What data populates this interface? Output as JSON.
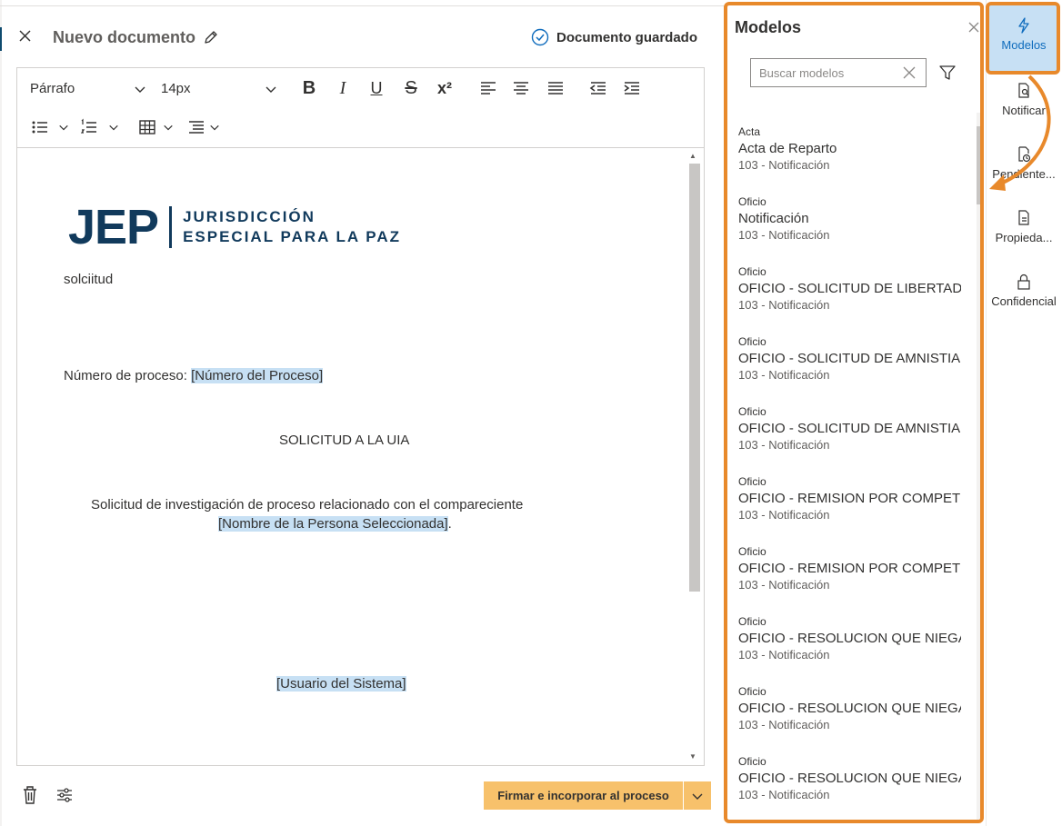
{
  "header": {
    "title": "Nuevo documento",
    "status": "Documento guardado"
  },
  "toolbar": {
    "paragraph_style": "Párrafo",
    "font_size": "14px",
    "bold": "B",
    "italic": "I",
    "underline": "U",
    "strikethrough": "S",
    "superscript": "x²"
  },
  "document": {
    "logo_main": "JEP",
    "logo_line1": "JURISDICCIÓN",
    "logo_line2": "ESPECIAL PARA LA PAZ",
    "line1": "solciitud",
    "process_label": "Número de proceso: ",
    "process_placeholder": "[Número del Proceso]",
    "heading": "SOLICITUD A LA UIA",
    "body_line1": "Solicitud  de investigación de proceso  relacionado  con  el  compareciente",
    "body_placeholder": "[Nombre de la Persona Seleccionada]",
    "body_end": ".",
    "signature_placeholder": "[Usuario del Sistema]"
  },
  "footer": {
    "sign_button": "Firmar e incorporar al proceso"
  },
  "models_panel": {
    "title": "Modelos",
    "search_placeholder": "Buscar modelos",
    "items": [
      {
        "type": "Acta",
        "name": "Acta de Reparto",
        "sub": "103 - Notificación"
      },
      {
        "type": "Oficio",
        "name": "Notificación",
        "sub": "103 - Notificación"
      },
      {
        "type": "Oficio",
        "name": "OFICIO - SOLICITUD DE LIBERTAD C",
        "sub": "103 - Notificación"
      },
      {
        "type": "Oficio",
        "name": "OFICIO - SOLICITUD DE AMNISTIA",
        "sub": "103 - Notificación"
      },
      {
        "type": "Oficio",
        "name": "OFICIO - SOLICITUD DE AMNISTIA",
        "sub": "103 - Notificación"
      },
      {
        "type": "Oficio",
        "name": "OFICIO - REMISION POR COMPETE",
        "sub": "103 - Notificación"
      },
      {
        "type": "Oficio",
        "name": "OFICIO - REMISION POR COMPETE",
        "sub": "103 - Notificación"
      },
      {
        "type": "Oficio",
        "name": "OFICIO - RESOLUCION QUE NIEGA",
        "sub": "103 - Notificación"
      },
      {
        "type": "Oficio",
        "name": "OFICIO - RESOLUCION QUE NIEGA",
        "sub": "103 - Notificación"
      },
      {
        "type": "Oficio",
        "name": "OFICIO - RESOLUCION QUE NIEGA",
        "sub": "103 - Notificación"
      }
    ]
  },
  "rail": {
    "items": [
      {
        "label": "Modelos",
        "icon": "lightning-icon",
        "active": true
      },
      {
        "label": "Notificar",
        "icon": "document-search-icon"
      },
      {
        "label": "Pendiente...",
        "icon": "document-clock-icon"
      },
      {
        "label": "Propieda...",
        "icon": "document-properties-icon"
      },
      {
        "label": "Confidencial",
        "icon": "lock-icon"
      }
    ]
  },
  "colors": {
    "accent_orange": "#e8892b",
    "sign_button": "#f7c16b",
    "highlight": "#c7e0f4",
    "brand_blue": "#113a5c",
    "link_blue": "#0f6cbd"
  }
}
